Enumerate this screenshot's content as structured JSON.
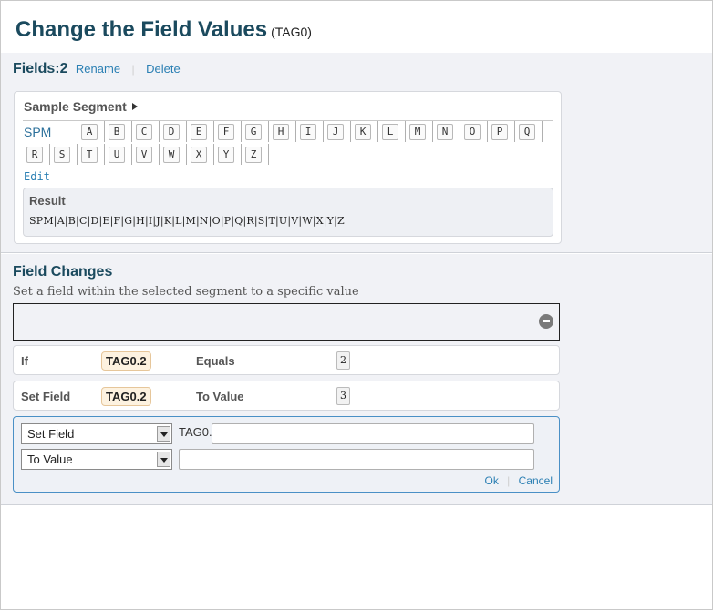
{
  "page": {
    "title": "Change the Field Values",
    "subtitle": "(TAG0)"
  },
  "fields": {
    "count_label": "Fields:2",
    "rename": "Rename",
    "delete": "Delete"
  },
  "sample": {
    "title": "Sample Segment",
    "segment_id": "SPM",
    "keys": [
      "A",
      "B",
      "C",
      "D",
      "E",
      "F",
      "G",
      "H",
      "I",
      "J",
      "K",
      "L",
      "M",
      "N",
      "O",
      "P",
      "Q",
      "R",
      "S",
      "T",
      "U",
      "V",
      "W",
      "X",
      "Y",
      "Z"
    ],
    "edit": "Edit",
    "result_label": "Result",
    "result_value": "SPM|A|B|C|D|E|F|G|H|I|J|K|L|M|N|O|P|Q|R|S|T|U|V|W|X|Y|Z"
  },
  "changes": {
    "title": "Field Changes",
    "description": "Set a field within the selected segment to a specific value",
    "conditions": [
      {
        "label": "If",
        "tag": "TAG0.2",
        "operator": "Equals",
        "value": "2"
      },
      {
        "label": "Set Field",
        "tag": "TAG0.2",
        "operator": "To Value",
        "value": "3"
      }
    ],
    "editor": {
      "field_select": "Set Field",
      "value_select": "To Value",
      "tag_prefix": "TAG0.",
      "field_value": "",
      "value_value": "",
      "ok": "Ok",
      "cancel": "Cancel"
    }
  }
}
